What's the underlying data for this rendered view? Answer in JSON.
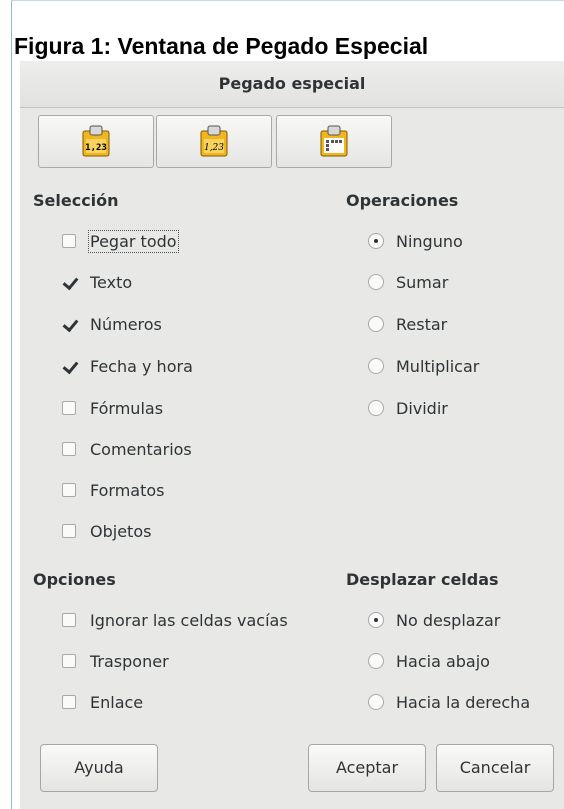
{
  "caption": "Figura 1: Ventana de Pegado Especial",
  "dialog": {
    "title": "Pegado especial",
    "presets": [
      {
        "name": "values-only-preset",
        "text": "1,23"
      },
      {
        "name": "values-formats-preset",
        "text": "1,23"
      },
      {
        "name": "transpose-preset",
        "text": ""
      }
    ],
    "seleccion": {
      "heading": "Selección",
      "items": [
        {
          "label": "Pegar todo",
          "checked": false
        },
        {
          "label": "Texto",
          "checked": true
        },
        {
          "label": "Números",
          "checked": true
        },
        {
          "label": "Fecha y hora",
          "checked": true
        },
        {
          "label": "Fórmulas",
          "checked": false
        },
        {
          "label": "Comentarios",
          "checked": false
        },
        {
          "label": "Formatos",
          "checked": false
        },
        {
          "label": "Objetos",
          "checked": false
        }
      ]
    },
    "operaciones": {
      "heading": "Operaciones",
      "selected": "Ninguno",
      "items": [
        "Ninguno",
        "Sumar",
        "Restar",
        "Multiplicar",
        "Dividir"
      ]
    },
    "opciones": {
      "heading": "Opciones",
      "items": [
        {
          "label": "Ignorar las celdas vacías",
          "checked": false
        },
        {
          "label": "Trasponer",
          "checked": false
        },
        {
          "label": "Enlace",
          "checked": false
        }
      ]
    },
    "desplazar": {
      "heading": "Desplazar celdas",
      "selected": "No desplazar",
      "items": [
        "No desplazar",
        "Hacia abajo",
        "Hacia la derecha"
      ]
    },
    "buttons": {
      "help": "Ayuda",
      "ok": "Aceptar",
      "cancel": "Cancelar"
    }
  }
}
